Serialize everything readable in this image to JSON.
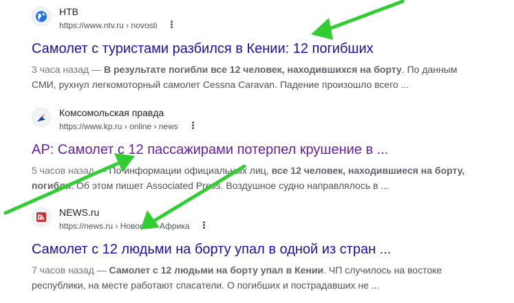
{
  "results": [
    {
      "site_name": "НТВ",
      "url_host": "https://www.ntv.ru",
      "url_path": "› novosti",
      "title": "Самолет с туристами разбился в Кении: 12 погибших",
      "date": "3 часа назад — ",
      "snippet_bold": "В результате погибли все 12 человек, находившихся на борту",
      "snippet_rest": ". По данным СМИ, рухнул легкомоторный самолет Cessna Caravan. Падение произошло всего ..."
    },
    {
      "site_name": "Комсомольская правда",
      "url_host": "https://www.kp.ru",
      "url_path": "› online › news",
      "title": "AP: Самолет с 12 пассажирами потерпел крушение в ...",
      "date": "5 часов назад — ",
      "snippet_pre": "По информации официальных лиц, ",
      "snippet_bold": "все 12 человек, находившиеся на борту, погибли",
      "snippet_rest": ". Об этом пишет Associated Press. Воздушное судно направлялось в ..."
    },
    {
      "site_name": "NEWS.ru",
      "url_host": "https://news.ru",
      "url_path": "› Новости › Африка",
      "title": "Самолет с 12 людьми на борту упал в одной из стран ...",
      "date": "7 часов назад — ",
      "snippet_bold": "Самолет с 12 людьми на борту упал в Кении",
      "snippet_rest": ". ЧП случилось на востоке республики, на месте работают спасатели. О погибших и пострадавших не ..."
    }
  ],
  "icons": {
    "r1": "globe-icon",
    "r2": "kp-logo-icon",
    "r3": "news-ru-logo-icon",
    "menu": "more-vert-icon"
  },
  "colors": {
    "link": "#1a0dab",
    "visited": "#681da8",
    "arrow": "#32cd32"
  }
}
